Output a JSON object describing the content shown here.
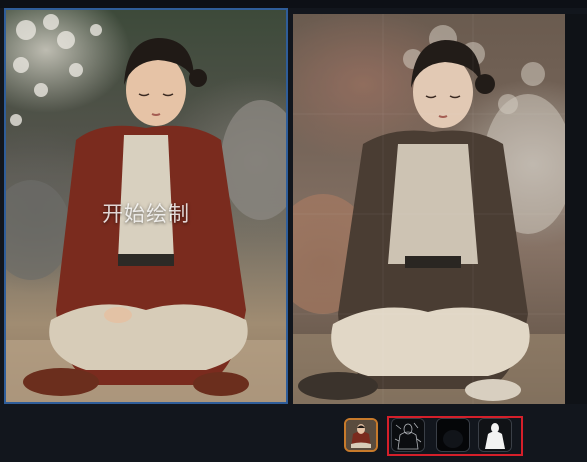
{
  "source_panel": {
    "overlay_label": "开始绘制"
  },
  "thumbnails": [
    {
      "name": "original"
    },
    {
      "name": "edge-map"
    },
    {
      "name": "dark-preview"
    },
    {
      "name": "mask-preview"
    }
  ],
  "colors": {
    "background": "#12161d",
    "selected_panel_border": "#2f5d99",
    "selected_thumb_border": "#c77a2b",
    "group_highlight": "#d51f2a"
  }
}
